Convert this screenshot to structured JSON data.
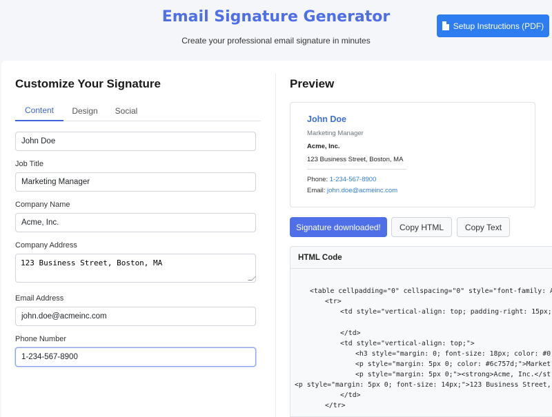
{
  "header": {
    "title": "Email Signature Generator",
    "subtitle": "Create your professional email signature in minutes",
    "setup_button": "Setup Instructions (PDF)"
  },
  "form": {
    "title": "Customize Your Signature",
    "tabs": [
      {
        "label": "Content",
        "active": true
      },
      {
        "label": "Design",
        "active": false
      },
      {
        "label": "Social",
        "active": false
      }
    ],
    "full_name": {
      "value": "John Doe"
    },
    "job_title": {
      "label": "Job Title",
      "value": "Marketing Manager"
    },
    "company_name": {
      "label": "Company Name",
      "value": "Acme, Inc."
    },
    "company_address": {
      "label": "Company Address",
      "value": "123 Business Street, Boston, MA"
    },
    "email": {
      "label": "Email Address",
      "value": "john.doe@acmeinc.com"
    },
    "phone": {
      "label": "Phone Number",
      "value": "1-234-567-8900"
    }
  },
  "preview": {
    "title": "Preview",
    "signature": {
      "name": "John Doe",
      "job_title": "Marketing Manager",
      "company": "Acme, Inc.",
      "address": "123 Business Street, Boston, MA",
      "phone_label": "Phone: ",
      "phone": "1-234-567-8900",
      "email_label": "Email: ",
      "email": "john.doe@acmeinc.com"
    },
    "buttons": {
      "download": "Signature downloaded!",
      "copy_html": "Copy HTML",
      "copy_text": "Copy Text"
    },
    "code": {
      "title": "HTML Code",
      "lines": [
        "<table cellpadding=\"0\" cellspacing=\"0\" style=\"font-family: A",
        "<tr>",
        "<td style=\"vertical-align: top; padding-right: 15px;",
        "</td>",
        "<td style=\"vertical-align: top;\">",
        "<h3 style=\"margin: 0; font-size: 18px; color: #0",
        "<p style=\"margin: 5px 0; color: #6c757d;\">Market",
        "<p style=\"margin: 5px 0;\"><strong>Acme, Inc.</st",
        "<p style=\"margin: 5px 0; font-size: 14px;\">123 Business Street,",
        "</td>",
        "</tr>"
      ]
    }
  },
  "colors": {
    "accent": "#4f6fe8",
    "setup_button": "#2d7cf0",
    "link": "#2f7fe0"
  }
}
